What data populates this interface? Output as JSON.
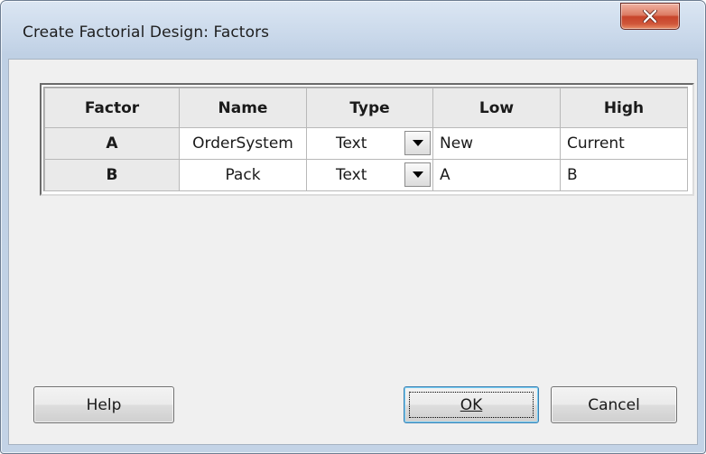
{
  "window": {
    "title": "Create Factorial Design: Factors",
    "close_icon": "close-icon"
  },
  "grid": {
    "headers": [
      "Factor",
      "Name",
      "Type",
      "Low",
      "High"
    ],
    "rows": [
      {
        "factor": "A",
        "name": "OrderSystem",
        "type": "Text",
        "low": "New",
        "high": "Current"
      },
      {
        "factor": "B",
        "name": "Pack",
        "type": "Text",
        "low": "A",
        "high": "B"
      }
    ]
  },
  "buttons": {
    "help": "Help",
    "ok": "OK",
    "cancel": "Cancel"
  }
}
